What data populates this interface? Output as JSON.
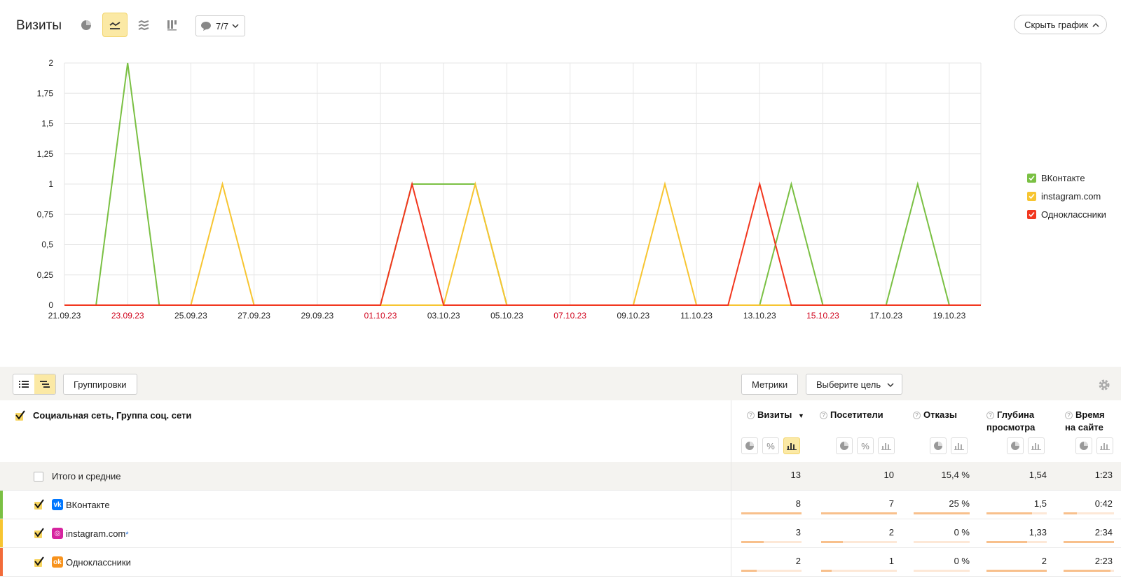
{
  "toolbar": {
    "title": "Визиты",
    "annotations_count": "7/7",
    "hide_chart_label": "Скрыть график"
  },
  "chart_data": {
    "type": "line",
    "x": [
      "21.09.23",
      "22.09.23",
      "23.09.23",
      "24.09.23",
      "25.09.23",
      "26.09.23",
      "27.09.23",
      "28.09.23",
      "29.09.23",
      "30.09.23",
      "01.10.23",
      "02.10.23",
      "03.10.23",
      "04.10.23",
      "05.10.23",
      "06.10.23",
      "07.10.23",
      "08.10.23",
      "09.10.23",
      "10.10.23",
      "11.10.23",
      "12.10.23",
      "13.10.23",
      "14.10.23",
      "15.10.23",
      "16.10.23",
      "17.10.23",
      "18.10.23",
      "19.10.23",
      "20.10.23"
    ],
    "x_tick_labels": [
      "21.09.23",
      "23.09.23",
      "25.09.23",
      "27.09.23",
      "29.09.23",
      "01.10.23",
      "03.10.23",
      "05.10.23",
      "07.10.23",
      "09.10.23",
      "11.10.23",
      "13.10.23",
      "15.10.23",
      "17.10.23",
      "19.10.23"
    ],
    "weekend_tick_labels": [
      "23.09.23",
      "01.10.23",
      "07.10.23",
      "15.10.23"
    ],
    "y_tick_labels": [
      "0",
      "0,25",
      "0,5",
      "0,75",
      "1",
      "1,25",
      "1,5",
      "1,75",
      "2"
    ],
    "ylim": [
      0,
      2
    ],
    "grid": true,
    "legend_position": "right",
    "series": [
      {
        "name": "ВКонтакте",
        "color": "#7ac043",
        "values": [
          0,
          0,
          2,
          0,
          0,
          0,
          0,
          0,
          0,
          0,
          0,
          1,
          1,
          1,
          0,
          0,
          0,
          0,
          0,
          0,
          0,
          0,
          0,
          1,
          0,
          0,
          0,
          1,
          0,
          0
        ]
      },
      {
        "name": "instagram.com",
        "color": "#f7c531",
        "values": [
          0,
          0,
          0,
          0,
          0,
          1,
          0,
          0,
          0,
          0,
          0,
          0,
          0,
          1,
          0,
          0,
          0,
          0,
          0,
          1,
          0,
          0,
          0,
          0,
          0,
          0,
          0,
          0,
          0,
          0
        ]
      },
      {
        "name": "Одноклассники",
        "color": "#f2371f",
        "values": [
          0,
          0,
          0,
          0,
          0,
          0,
          0,
          0,
          0,
          0,
          0,
          1,
          0,
          0,
          0,
          0,
          0,
          0,
          0,
          0,
          0,
          0,
          1,
          0,
          0,
          0,
          0,
          0,
          0,
          0
        ]
      }
    ]
  },
  "table_toolbar": {
    "groupings_label": "Группировки",
    "metrics_label": "Метрики",
    "goal_label": "Выберите цель"
  },
  "table": {
    "dimension_header": "Социальная сеть, Группа соц. сети",
    "metric_headers": {
      "visits": "Визиты",
      "visitors": "Посетители",
      "bounces": "Отказы",
      "depth_line1": "Глубина",
      "depth_line2": "просмотра",
      "time_line1": "Время",
      "time_line2": "на сайте"
    },
    "total": {
      "label": "Итого и средние",
      "visits": "13",
      "visitors": "10",
      "bounces": "15,4 %",
      "depth": "1,54",
      "time": "1:23"
    },
    "rows": [
      {
        "label": "ВКонтакте",
        "color": "#7ac043",
        "icon": "vk-icon",
        "visits": "8",
        "visitors": "7",
        "bounces": "25 %",
        "depth": "1,5",
        "time": "0:42",
        "share": {
          "visits": 1.0,
          "visitors": 1.0,
          "bounces": 1.0,
          "depth": 0.75,
          "time": 0.27
        }
      },
      {
        "label": "instagram.com",
        "color": "#f7c531",
        "icon": "instagram-icon",
        "external_mark": "*",
        "visits": "3",
        "visitors": "2",
        "bounces": "0 %",
        "depth": "1,33",
        "time": "2:34",
        "share": {
          "visits": 0.375,
          "visitors": 0.29,
          "bounces": 0.0,
          "depth": 0.67,
          "time": 1.0
        }
      },
      {
        "label": "Одноклассники",
        "color": "#f26b3a",
        "icon": "odnoklassniki-icon",
        "visits": "2",
        "visitors": "1",
        "bounces": "0 %",
        "depth": "2",
        "time": "2:23",
        "share": {
          "visits": 0.25,
          "visitors": 0.14,
          "bounces": 0.0,
          "depth": 1.0,
          "time": 0.93
        }
      }
    ]
  },
  "colors": {
    "accent_yellow": "#fbe9a5",
    "weekend_red": "#d0021b"
  }
}
